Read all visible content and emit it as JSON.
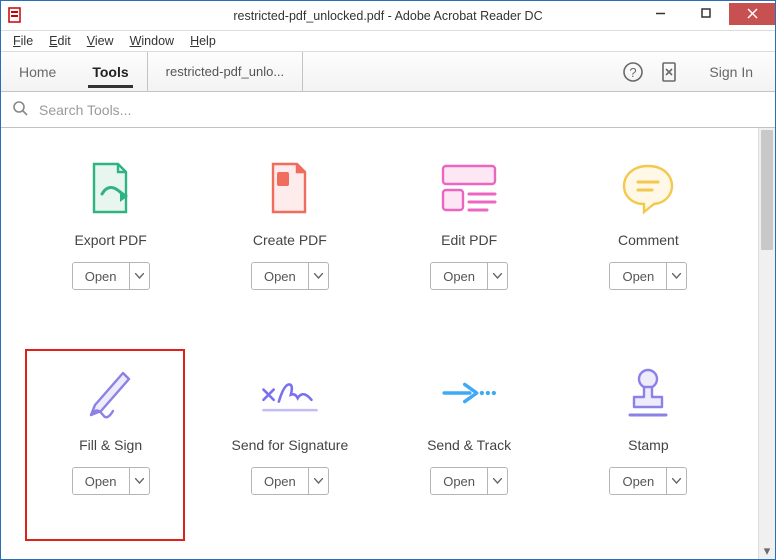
{
  "window": {
    "title": "restricted-pdf_unlocked.pdf - Adobe Acrobat Reader DC"
  },
  "menu": {
    "file": "File",
    "edit": "Edit",
    "view": "View",
    "window": "Window",
    "help": "Help"
  },
  "topnav": {
    "home": "Home",
    "tools": "Tools",
    "tab": "restricted-pdf_unlo...",
    "signin": "Sign In"
  },
  "search": {
    "placeholder": "Search Tools..."
  },
  "tools": [
    {
      "id": "export-pdf",
      "label": "Export PDF",
      "open": "Open"
    },
    {
      "id": "create-pdf",
      "label": "Create PDF",
      "open": "Open"
    },
    {
      "id": "edit-pdf",
      "label": "Edit PDF",
      "open": "Open"
    },
    {
      "id": "comment",
      "label": "Comment",
      "open": "Open"
    },
    {
      "id": "fill-sign",
      "label": "Fill & Sign",
      "open": "Open"
    },
    {
      "id": "send-sig",
      "label": "Send for Signature",
      "open": "Open"
    },
    {
      "id": "send-track",
      "label": "Send & Track",
      "open": "Open"
    },
    {
      "id": "stamp",
      "label": "Stamp",
      "open": "Open"
    }
  ]
}
